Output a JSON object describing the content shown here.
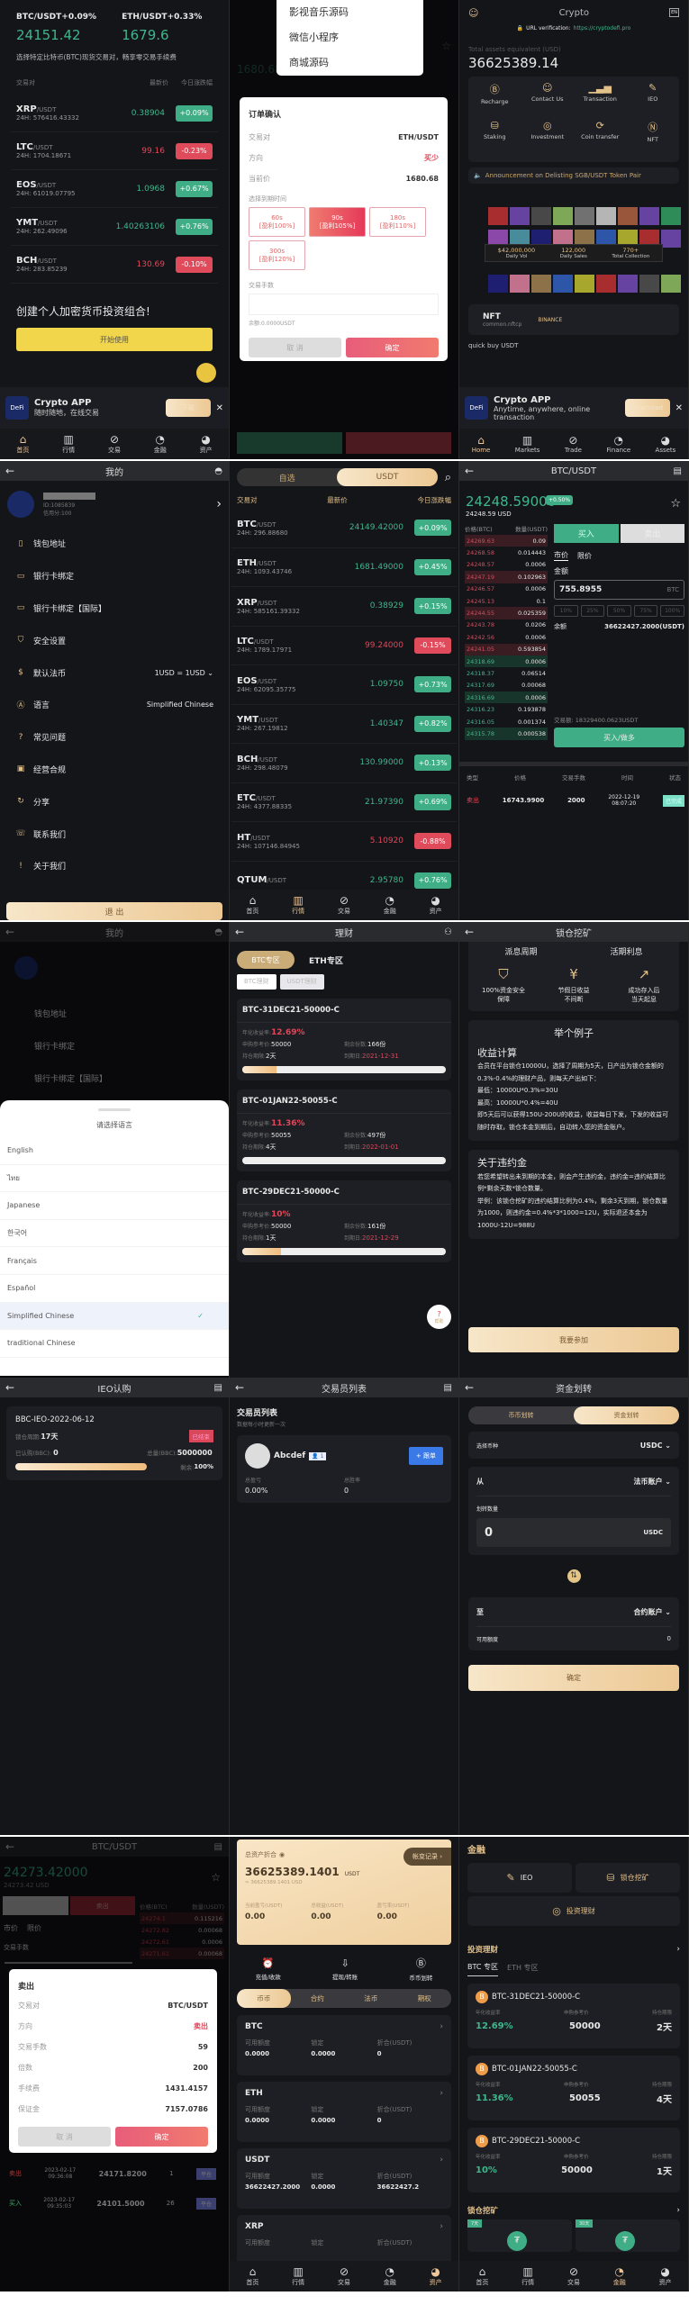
{
  "nav_cn": [
    "首页",
    "行情",
    "交易",
    "金融",
    "资产"
  ],
  "nav_en": [
    "Home",
    "Markets",
    "Trade",
    "Finance",
    "Assets"
  ],
  "colors": {
    "up": "#3fb68b",
    "down": "#e0475a",
    "gold": "#e2c08a",
    "bg": "#141519"
  },
  "home_cn": {
    "tickers": [
      {
        "pair": "BTC/USDT",
        "change": "+0.09%",
        "price": "24151.42"
      },
      {
        "pair": "ETH/USDT",
        "change": "+0.33%",
        "price": "1679.6"
      }
    ],
    "tagline": "选择特定比特币(BTC)现货交易对，畅享零交易手续费",
    "headers": [
      "交易对",
      "最新价",
      "今日涨跌幅"
    ],
    "rows": [
      {
        "coin": "XRP",
        "quote": "/USDT",
        "vol": "24H: 576416.43332",
        "price": "0.38904",
        "change": "+0.09%",
        "up": true
      },
      {
        "coin": "LTC",
        "quote": "/USDT",
        "vol": "24H: 1704.18671",
        "price": "99.16",
        "change": "-0.23%",
        "up": false
      },
      {
        "coin": "EOS",
        "quote": "/USDT",
        "vol": "24H: 61019.07795",
        "price": "1.0968",
        "change": "+0.67%",
        "up": true
      },
      {
        "coin": "YMT",
        "quote": "/USDT",
        "vol": "24H: 262.49096",
        "price": "1.40263106",
        "change": "+0.76%",
        "up": true
      },
      {
        "coin": "BCH",
        "quote": "/USDT",
        "vol": "24H: 283.85239",
        "price": "130.69",
        "change": "-0.10%",
        "up": false
      }
    ],
    "cta_title": "创建个人加密货币投资组合!",
    "cta_button": "开始使用",
    "banner": {
      "title": "Crypto APP",
      "subtitle": "随时随地，在线交易",
      "button": "下载"
    }
  },
  "order_dialog": {
    "menu": [
      "影视音乐源码",
      "微信小程序",
      "商城源码"
    ],
    "bg_price": "1680.68",
    "title": "订单确认",
    "rows": [
      {
        "label": "交易对",
        "value": "ETH/USDT"
      },
      {
        "label": "方向",
        "value": "买少"
      },
      {
        "label": "当前价",
        "value": "1680.68"
      }
    ],
    "expiry_label": "选择到期时间",
    "options": [
      {
        "time": "60s",
        "profit": "[盈利100%]"
      },
      {
        "time": "90s",
        "profit": "[盈利105%]",
        "selected": true
      },
      {
        "time": "180s",
        "profit": "[盈利110%]"
      },
      {
        "time": "300s",
        "profit": "[盈利120%]"
      }
    ],
    "lots_label": "交易手数",
    "lots_value": "",
    "balance": "余额:0.0000USDT",
    "cancel": "取 消",
    "confirm": "确定"
  },
  "home_en": {
    "title": "Crypto",
    "lang_badge": "EN",
    "url_label": "URL verification:",
    "url": "https://cryptodefi.pro",
    "assets_label": "Total assets equivalent (USD)",
    "assets": "36625389.14",
    "actions": [
      "Recharge",
      "Contact Us",
      "Transaction",
      "IEO",
      "Staking",
      "Investment",
      "Coin transfer",
      "NFT"
    ],
    "announcement": "Announcement on Delisting SGB/USDT Token Pair",
    "stats": [
      {
        "value": "$42,000,000",
        "label": "Daily Vol"
      },
      {
        "value": "122,000",
        "label": "Daily Sales"
      },
      {
        "value": "770+",
        "label": "Total Collection"
      }
    ],
    "nft_title": "NFT",
    "nft_sub": "common.nftcp",
    "nft_brand": "BINANCE",
    "quick_buy": "quick buy USDT",
    "banner": {
      "title": "Crypto APP",
      "subtitle": "Anytime, anywhere, online transaction",
      "button": "Download"
    }
  },
  "profile": {
    "title": "我的",
    "id": "ID:1085839",
    "credit": "信用分:100",
    "items": [
      {
        "label": "钱包地址",
        "icon": "wallet"
      },
      {
        "label": "银行卡绑定",
        "icon": "card"
      },
      {
        "label": "银行卡绑定【国际】",
        "icon": "card"
      },
      {
        "label": "安全设置",
        "icon": "shield"
      },
      {
        "label": "默认法币",
        "icon": "dollar",
        "value": "1USD = 1USD ⌄"
      },
      {
        "label": "语言",
        "icon": "language",
        "value": "Simplified Chinese"
      },
      {
        "label": "常见问题",
        "icon": "question"
      },
      {
        "label": "经营合规",
        "icon": "compliance"
      },
      {
        "label": "分享",
        "icon": "share"
      },
      {
        "label": "联系我们",
        "icon": "contact"
      },
      {
        "label": "关于我们",
        "icon": "info"
      }
    ],
    "logout": "退 出"
  },
  "markets": {
    "tabs": [
      "自选",
      "USDT"
    ],
    "headers": [
      "交易对",
      "最新价",
      "今日涨跌幅"
    ],
    "rows": [
      {
        "coin": "BTC",
        "quote": "/USDT",
        "vol": "24H: 296.88680",
        "price": "24149.42000",
        "change": "+0.09%",
        "up": true
      },
      {
        "coin": "ETH",
        "quote": "/USDT",
        "vol": "24H: 1093.43746",
        "price": "1681.49000",
        "change": "+0.45%",
        "up": true
      },
      {
        "coin": "XRP",
        "quote": "/USDT",
        "vol": "24H: 585161.39332",
        "price": "0.38929",
        "change": "+0.15%",
        "up": true
      },
      {
        "coin": "LTC",
        "quote": "/USDT",
        "vol": "24H: 1789.17971",
        "price": "99.24000",
        "change": "-0.15%",
        "up": false
      },
      {
        "coin": "EOS",
        "quote": "/USDT",
        "vol": "24H: 62095.35775",
        "price": "1.09750",
        "change": "+0.73%",
        "up": true
      },
      {
        "coin": "YMT",
        "quote": "/USDT",
        "vol": "24H: 267.19812",
        "price": "1.40347",
        "change": "+0.82%",
        "up": true
      },
      {
        "coin": "BCH",
        "quote": "/USDT",
        "vol": "24H: 298.48079",
        "price": "130.99000",
        "change": "+0.13%",
        "up": true
      },
      {
        "coin": "ETC",
        "quote": "/USDT",
        "vol": "24H: 4377.88335",
        "price": "21.97390",
        "change": "+0.69%",
        "up": true
      },
      {
        "coin": "HT",
        "quote": "/USDT",
        "vol": "24H: 107146.84945",
        "price": "5.10920",
        "change": "-0.88%",
        "up": false
      },
      {
        "coin": "QTUM",
        "quote": "/USDT",
        "vol": "",
        "price": "2.95780",
        "change": "+0.76%",
        "up": true
      }
    ]
  },
  "spot": {
    "title": "BTC/USDT",
    "price": "24248.59000",
    "change": "+0.50%",
    "usd": "24248.59 USD",
    "book_headers": [
      "价格(BTC)",
      "数量(USDT)"
    ],
    "asks": [
      [
        "24269.63",
        "0.09"
      ],
      [
        "24268.58",
        "0.014443"
      ],
      [
        "24248.57",
        "0.0006"
      ],
      [
        "24247.19",
        "0.102963"
      ],
      [
        "24246.57",
        "0.0006"
      ],
      [
        "24245.13",
        "0.1"
      ],
      [
        "24244.55",
        "0.025359"
      ],
      [
        "24243.78",
        "0.0206"
      ],
      [
        "24242.56",
        "0.0006"
      ],
      [
        "24241.05",
        "0.593854"
      ]
    ],
    "bids": [
      [
        "24318.69",
        "0.0006"
      ],
      [
        "24318.37",
        "0.06514"
      ],
      [
        "24317.69",
        "0.00068"
      ],
      [
        "24316.69",
        "0.0006"
      ],
      [
        "24316.23",
        "0.193878"
      ],
      [
        "24316.05",
        "0.001374"
      ],
      [
        "24315.78",
        "0.000538"
      ]
    ],
    "buy_tab": "买入",
    "sell_tab": "卖出",
    "order_types": [
      "市价",
      "限价"
    ],
    "amount_label": "金额",
    "amount": "755.8955",
    "amount_unit": "BTC",
    "percents": [
      "10%",
      "25%",
      "50%",
      "75%",
      "100%"
    ],
    "balance_label": "余额",
    "balance": "36622427.2000(USDT)",
    "turnover": "交易额:  18329400.0623USDT",
    "submit": "买入/做多",
    "history_headers": [
      "类型",
      "价格",
      "交易手数",
      "时间",
      "状态"
    ],
    "history": [
      {
        "type": "卖出",
        "price": "16743.9900",
        "lots": "2000",
        "date": "2022-12-19",
        "time": "08:07:20",
        "status": "已完成"
      }
    ]
  },
  "language": {
    "bg_title": "我的",
    "bg_items": [
      "钱包地址",
      "银行卡绑定",
      "银行卡绑定【国际】"
    ],
    "sheet_title": "请选择语言",
    "options": [
      "English",
      "ไทย",
      "Japanese",
      "한국어",
      "Français",
      "Español",
      "Simplified Chinese",
      "traditional Chinese"
    ],
    "selected": "Simplified Chinese"
  },
  "finance": {
    "title": "理财",
    "zones": [
      "BTC专区",
      "ETH专区"
    ],
    "subtabs": [
      "BTC理财",
      "USDT理财"
    ],
    "labels": {
      "rate": "年化收益率:",
      "ref": "申购参考价:",
      "remain": "剩余份数:",
      "term": "持仓期限:",
      "due": "到期日:"
    },
    "products": [
      {
        "name": "BTC-31DEC21-50000-C",
        "rate": "12.69%",
        "ref": "50000",
        "remain": "166份",
        "term": "2天",
        "due": "2021-12-31",
        "progress": 0.17
      },
      {
        "name": "BTC-01JAN22-50055-C",
        "rate": "11.36%",
        "ref": "50055",
        "remain": "497份",
        "term": "4天",
        "due": "2022-01-01",
        "progress": 0.0
      },
      {
        "name": "BTC-29DEC21-50000-C",
        "rate": "10%",
        "ref": "50000",
        "remain": "161份",
        "term": "1天",
        "due": "2021-12-29",
        "progress": 0.19
      }
    ],
    "help": "帮助"
  },
  "staking": {
    "title": "锁仓挖矿",
    "top": [
      "派息周期",
      "活期利息"
    ],
    "features": [
      [
        "100%资金安全",
        "保障"
      ],
      [
        "节假日收益",
        "不间断"
      ],
      [
        "成功存入后",
        "当天起息"
      ]
    ],
    "example_title": "举个例子",
    "income_title": "收益计算",
    "income_lines": [
      "会员在平台锁仓10000U，选择了周期为5天，日产出为锁仓金额的0.3%-0.4%的理财产品，则每天产出如下：",
      "最低：10000U*0.3%=30U",
      "最高：10000U*0.4%=40U",
      "即5天后可以获得150U-200U的收益，收益每日下发，下发的收益可随时存取，锁仓本金到期后，自动转入您的资金账户。"
    ],
    "penalty_title": "关于违约金",
    "penalty_lines": [
      "若您希望转出未到期的本金，则会产生违约金，违约金=违约结算比例*剩余天数*锁仓数量。",
      "举例：该锁仓挖矿的违约结算比例为0.4%，剩余3天到期，锁仓数量为1000，则违约金=0.4%*3*1000=12U，实际退还本金为1000U-12U=988U"
    ],
    "join": "我要参加"
  },
  "ieo": {
    "title": "IEO认购",
    "name": "BBC-IEO-2022-06-12",
    "period_label": "锁仓周期:",
    "period": "17天",
    "status": "已结束",
    "sub_label": "已认购(BBC):",
    "sub": "0",
    "total_label": "总量(BBC):",
    "total": "5000000",
    "remain_label": "剩余:",
    "remain": "100%",
    "progress": 1.0
  },
  "traders": {
    "title": "交易员列表",
    "heading": "交易员列表",
    "sub": "数据每小时更新一次",
    "name": "Abcdef",
    "followers": "1",
    "follow": "+ 跟单",
    "stats": [
      {
        "label": "总盈亏",
        "value": "0.00%"
      },
      {
        "label": "总胜率",
        "value": "0"
      }
    ]
  },
  "transfer": {
    "title": "资金划转",
    "tabs": [
      "币币划转",
      "资金划转"
    ],
    "coin_label": "选择币种",
    "coin": "USDC ⌄",
    "from_label": "从",
    "from": "法币账户 ⌄",
    "qty_label": "划转数量",
    "qty": "0",
    "qty_unit": "USDC",
    "to_label": "至",
    "to": "合约账户 ⌄",
    "avail_label": "可用额度",
    "avail": "0",
    "confirm": "确定"
  },
  "contract": {
    "title": "BTC/USDT",
    "price": "24273.42000",
    "usd": "24273.42 USD",
    "sell_tab": "卖出",
    "order_types": [
      "市价",
      "限价"
    ],
    "lots_label": "交易手数",
    "book_headers": [
      "价格(BTC)",
      "数量(USDT)"
    ],
    "asks": [
      [
        "24274.1",
        "0.115216"
      ],
      [
        "24272.82",
        "0.00068"
      ],
      [
        "24272.61",
        "0.0006"
      ],
      [
        "24271.61",
        "0.00068"
      ]
    ],
    "dialog": {
      "title": "卖出",
      "rows": [
        {
          "label": "交易对",
          "value": "BTC/USDT"
        },
        {
          "label": "方向",
          "value": "卖出"
        },
        {
          "label": "交易手数",
          "value": "59"
        },
        {
          "label": "倍数",
          "value": "200"
        },
        {
          "label": "手续费",
          "value": "1431.4157"
        },
        {
          "label": "保证金",
          "value": "7157.0786"
        }
      ],
      "cancel": "取 消",
      "confirm": "确定"
    },
    "history": [
      {
        "type": "卖出",
        "date": "2023-02-17",
        "time": "09:36:08",
        "price": "24171.8200",
        "lots": "1",
        "status": "平仓"
      },
      {
        "type": "买入",
        "date": "2023-02-17",
        "time": "09:35:03",
        "price": "24101.5000",
        "lots": "26",
        "status": "平仓"
      }
    ]
  },
  "assets": {
    "label": "总资产折合",
    "records": "帐变记录 ›",
    "total": "36625389.1401",
    "unit": "USDT",
    "approx": "≈ 36625389.1401 USD",
    "stats": [
      {
        "label": "当前盈亏(USDT)",
        "value": "0.00"
      },
      {
        "label": "总收益(USDT)",
        "value": "0.00"
      },
      {
        "label": "盈亏率(USDT)",
        "value": "0.00"
      }
    ],
    "actions": [
      "充值/收款",
      "提现/转账",
      "币币划转"
    ],
    "tabs": [
      "币币",
      "合约",
      "法币",
      "期权"
    ],
    "col_labels": [
      "可用额度",
      "锁定",
      "折合(USDT)"
    ],
    "coins": [
      {
        "name": "BTC",
        "values": [
          "0.0000",
          "0.0000",
          "0"
        ]
      },
      {
        "name": "ETH",
        "values": [
          "0.0000",
          "0.0000",
          "0"
        ]
      },
      {
        "name": "USDT",
        "values": [
          "36622427.2000",
          "0.0000",
          "36622427.2"
        ]
      },
      {
        "name": "XRP",
        "values": []
      }
    ]
  },
  "finance_home": {
    "title": "金融",
    "shortcuts": [
      "IEO",
      "锁仓挖矿",
      "投资理财"
    ],
    "section": "投资理财",
    "zones": [
      "BTC 专区",
      "ETH 专区"
    ],
    "labels": [
      "年化收益率",
      "申购参考价",
      "持仓期限"
    ],
    "products": [
      {
        "name": "BTC-31DEC21-50000-C",
        "rate": "12.69%",
        "ref": "50000",
        "term": "2天"
      },
      {
        "name": "BTC-01JAN22-50055-C",
        "rate": "11.36%",
        "ref": "50055",
        "term": "4天"
      },
      {
        "name": "BTC-29DEC21-50000-C",
        "rate": "10%",
        "ref": "50000",
        "term": "1天"
      }
    ],
    "staking_section": "锁仓挖矿",
    "staking_tags": [
      "7天",
      "30天"
    ]
  }
}
